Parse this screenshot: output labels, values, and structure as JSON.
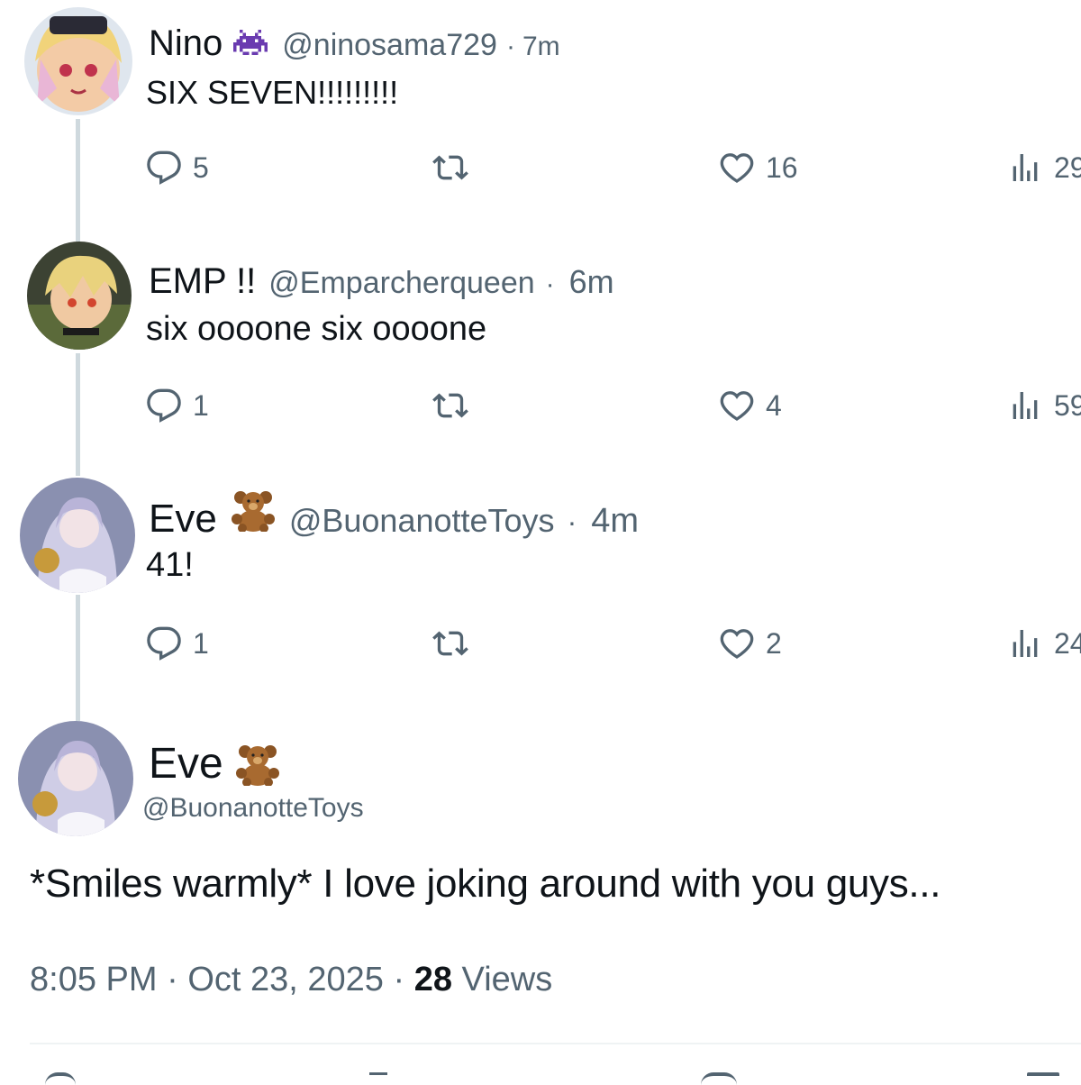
{
  "replies": [
    {
      "name": "Nino",
      "name_emoji": "space-invader-emoji",
      "handle": "@ninosama729",
      "separator": "·",
      "time": "7m",
      "text": "SIX SEVEN!!!!!!!!!",
      "replies_count": "5",
      "retweets_count": "",
      "likes_count": "16",
      "views_count": "29"
    },
    {
      "name": "EMP !!",
      "handle": "@Emparcherqueen",
      "separator": "·",
      "time": "6m",
      "text": "six oooone six oooone",
      "replies_count": "1",
      "retweets_count": "",
      "likes_count": "4",
      "views_count": "59"
    },
    {
      "name": "Eve",
      "name_emoji": "teddy-bear-emoji",
      "handle": "@BuonanotteToys",
      "separator": "·",
      "time": "4m",
      "text": "41!",
      "replies_count": "1",
      "retweets_count": "",
      "likes_count": "2",
      "views_count": "24"
    }
  ],
  "main_post": {
    "name": "Eve",
    "name_emoji": "teddy-bear-emoji",
    "handle": "@BuonanotteToys",
    "text": "*Smiles warmly* I love joking around with you guys...",
    "time": "8:05 PM",
    "separator": "·",
    "date": "Oct 23, 2025",
    "views_count": "28",
    "views_label": "Views"
  },
  "colors": {
    "text": "#0f1419",
    "secondary": "#536471",
    "thread_line": "#cfd9de",
    "divider": "#eff3f4"
  }
}
